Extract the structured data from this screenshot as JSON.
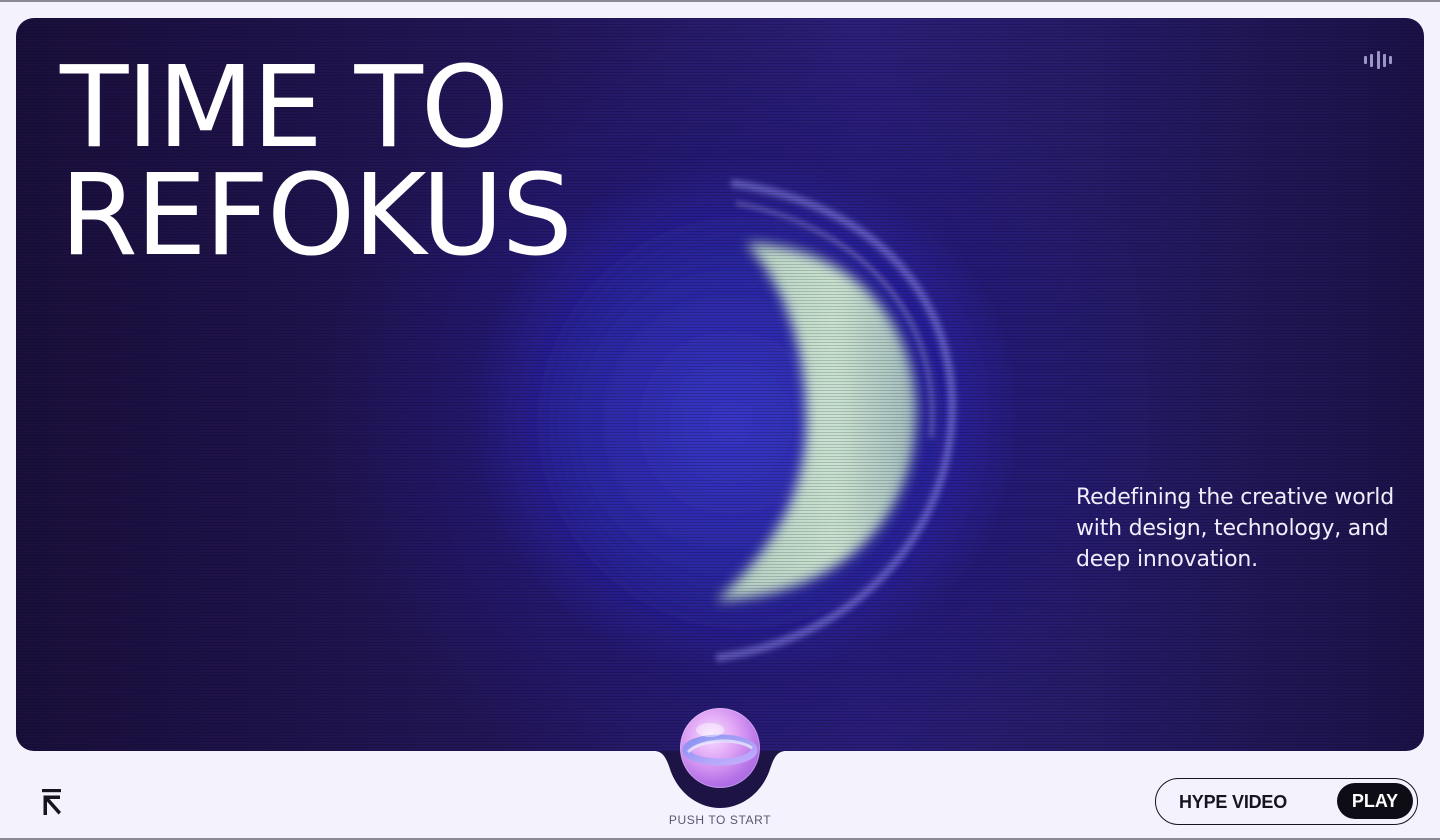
{
  "hero": {
    "title_line1": "TIME TO",
    "title_line2": "REFOKUS",
    "tagline": "Redefining the creative world with design, technology, and deep innovation."
  },
  "icons": {
    "sound": "sound-wave-icon",
    "logo": "refokus-logo-icon",
    "orb": "glass-orb-icon"
  },
  "start": {
    "label": "PUSH TO START"
  },
  "video": {
    "label": "HYPE VIDEO",
    "play_label": "PLAY"
  },
  "colors": {
    "page_background": "#f4f2fd",
    "hero_dark": "#1a0f3c",
    "hero_glow": "#3a3ae6",
    "orb_highlight": "#c9e8c9",
    "text_light": "#ffffff",
    "text_dark": "#16141f",
    "accent_pink": "#dfa3f5"
  }
}
